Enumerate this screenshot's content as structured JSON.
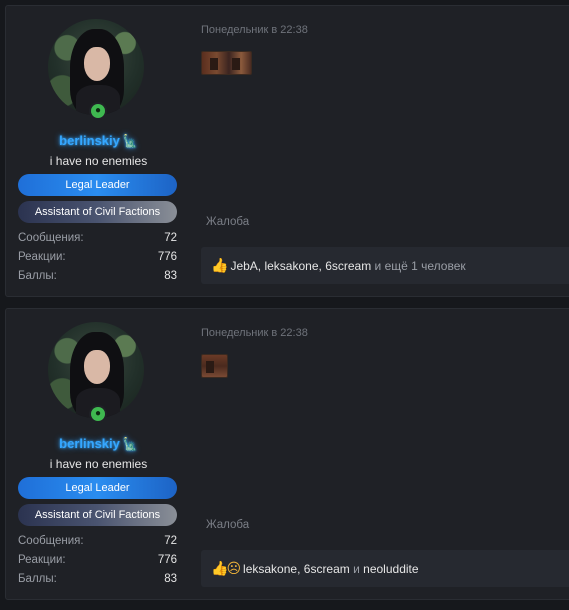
{
  "posts": [
    {
      "user": {
        "name": "berlinskiy",
        "badge_icon": "statue-of-liberty-icon",
        "title": "i have no enemies",
        "banners": [
          "Legal Leader",
          "Assistant of Civil Factions"
        ],
        "stats": [
          {
            "label": "Сообщения:",
            "value": "72"
          },
          {
            "label": "Реакции:",
            "value": "776"
          },
          {
            "label": "Баллы:",
            "value": "83"
          }
        ]
      },
      "date": "Понедельник в 22:38",
      "report": "Жалоба",
      "reactions": {
        "icons": [
          "thumbs-up-icon"
        ],
        "users": [
          "JebA",
          "leksakone",
          "6scream"
        ],
        "sep1": ", ",
        "sep2": ", ",
        "suffix": " и ещё 1 человек"
      }
    },
    {
      "user": {
        "name": "berlinskiy",
        "badge_icon": "statue-of-liberty-icon",
        "title": "i have no enemies",
        "banners": [
          "Legal Leader",
          "Assistant of Civil Factions"
        ],
        "stats": [
          {
            "label": "Сообщения:",
            "value": "72"
          },
          {
            "label": "Реакции:",
            "value": "776"
          },
          {
            "label": "Баллы:",
            "value": "83"
          }
        ]
      },
      "date": "Понедельник в 22:38",
      "report": "Жалоба",
      "reactions": {
        "icons": [
          "thumbs-up-icon",
          "sad-face-icon"
        ],
        "users": [
          "leksakone",
          "6scream",
          "neoluddite"
        ],
        "sep1": ", ",
        "sep2": " и "
      }
    }
  ],
  "colors": {
    "username_glow": "#35a7ff",
    "leader_banner": "#2a8df0",
    "online": "#3fb950",
    "background": "#16181c",
    "panel": "#1f2126"
  }
}
